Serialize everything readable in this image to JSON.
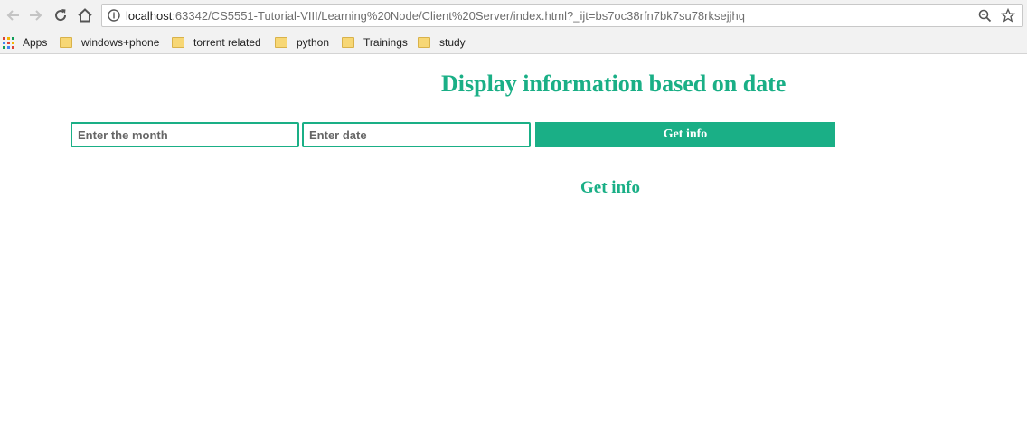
{
  "browser": {
    "url_host": "localhost",
    "url_rest": ":63342/CS5551-Tutorial-VIII/Learning%20Node/Client%20Server/index.html?_ijt=bs7oc38rfn7bk7su78rksejjhq",
    "bookmarks": [
      {
        "label": "Apps",
        "icon": "apps-grid-icon"
      },
      {
        "label": "windows+phone",
        "icon": "folder-icon"
      },
      {
        "label": "torrent related",
        "icon": "folder-icon"
      },
      {
        "label": "python",
        "icon": "folder-icon"
      },
      {
        "label": "Trainings",
        "icon": "folder-icon"
      },
      {
        "label": "study",
        "icon": "folder-icon"
      }
    ]
  },
  "page": {
    "title": "Display information based on date",
    "month_input": {
      "value": "",
      "placeholder": "Enter the month"
    },
    "date_input": {
      "value": "",
      "placeholder": "Enter date"
    },
    "get_info_button": "Get info",
    "result_heading": "Get info"
  },
  "colors": {
    "accent": "#1aaf86",
    "toolbar_bg": "#f2f2f2",
    "folder": "#f7d775"
  }
}
